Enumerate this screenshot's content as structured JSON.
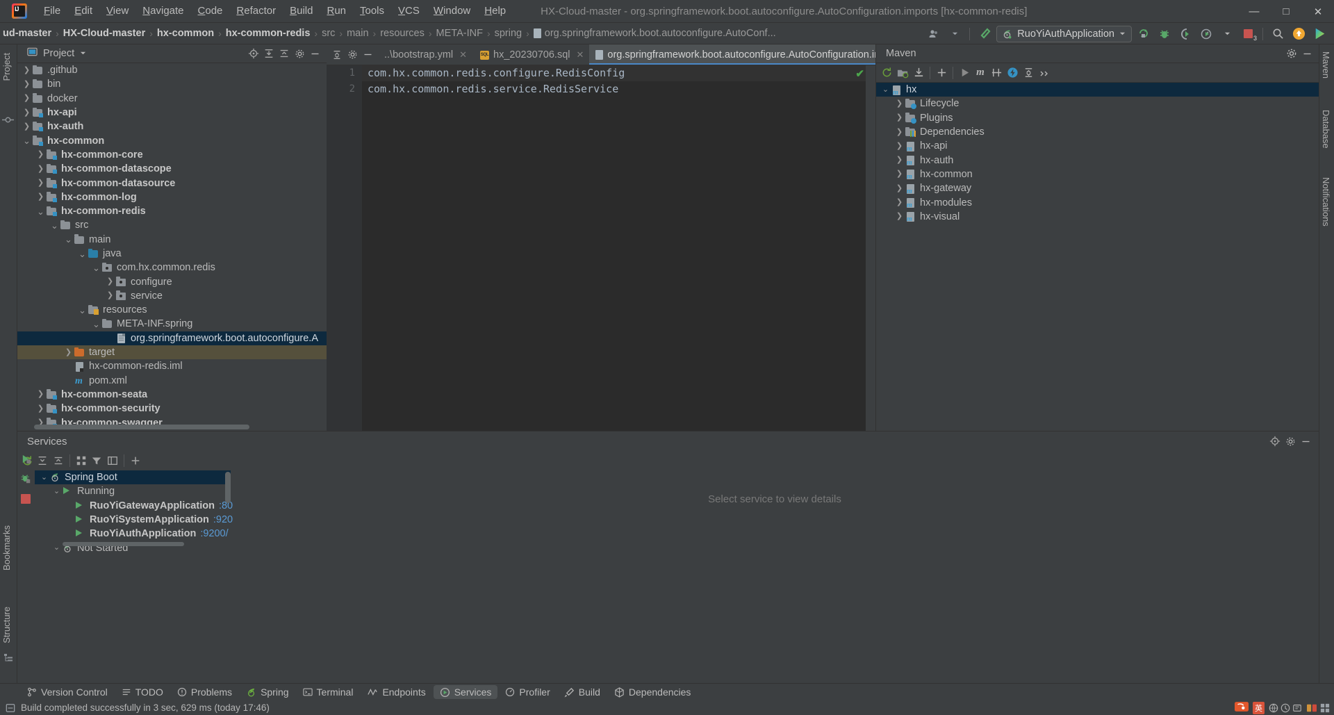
{
  "window": {
    "title": "HX-Cloud-master - org.springframework.boot.autoconfigure.AutoConfiguration.imports [hx-common-redis]",
    "minimize": "—",
    "maximize": "▢",
    "close": "✕"
  },
  "menu": [
    "File",
    "Edit",
    "View",
    "Navigate",
    "Code",
    "Refactor",
    "Build",
    "Run",
    "Tools",
    "VCS",
    "Window",
    "Help"
  ],
  "breadcrumbs": [
    {
      "label": "ud-master",
      "style": "bold"
    },
    {
      "label": "HX-Cloud-master",
      "style": "bold"
    },
    {
      "label": "hx-common",
      "style": "bold"
    },
    {
      "label": "hx-common-redis",
      "style": "bold"
    },
    {
      "label": "src",
      "style": "dim"
    },
    {
      "label": "main",
      "style": "dim"
    },
    {
      "label": "resources",
      "style": "dim"
    },
    {
      "label": "META-INF",
      "style": "dim"
    },
    {
      "label": "spring",
      "style": "dim"
    },
    {
      "label": "org.springframework.boot.autoconfigure.AutoConf...",
      "style": "dim"
    }
  ],
  "nav_toolbar": {
    "account_icon": "user-avatar-icon",
    "dropdown_icon": "chevron-down-icon",
    "build_icon": "hammer-icon",
    "run_config": "RuoYiAuthApplication",
    "run_config_icon": "spring-boot-icon",
    "rerun_icon": "rerun-icon",
    "debug_icon": "debug-icon",
    "coverage_icon": "coverage-icon",
    "profiler_icon": "profiler-icon",
    "more_icon": "chevron-down-icon",
    "stop_icon": "stop-icon",
    "stop_badge": "3",
    "search_icon": "search-icon",
    "update_icon": "update-arrow-icon",
    "ai_icon": "ai-assistant-icon"
  },
  "project_panel": {
    "title": "Project",
    "title_icon": "project-view-icon",
    "dropdown_icon": "chevron-down-icon",
    "actions": [
      "locate-icon",
      "expand-all-icon",
      "collapse-all-icon",
      "settings-icon",
      "hide-icon"
    ],
    "tree": [
      {
        "label": ".github",
        "depth": 2,
        "arrow": "right",
        "icon": "folder",
        "bold": false
      },
      {
        "label": "bin",
        "depth": 2,
        "arrow": "right",
        "icon": "folder",
        "bold": false
      },
      {
        "label": "docker",
        "depth": 2,
        "arrow": "right",
        "icon": "folder",
        "bold": false
      },
      {
        "label": "hx-api",
        "depth": 2,
        "arrow": "right",
        "icon": "module",
        "bold": true
      },
      {
        "label": "hx-auth",
        "depth": 2,
        "arrow": "right",
        "icon": "module",
        "bold": true
      },
      {
        "label": "hx-common",
        "depth": 2,
        "arrow": "down",
        "icon": "module",
        "bold": true
      },
      {
        "label": "hx-common-core",
        "depth": 3,
        "arrow": "right",
        "icon": "module",
        "bold": true
      },
      {
        "label": "hx-common-datascope",
        "depth": 3,
        "arrow": "right",
        "icon": "module",
        "bold": true
      },
      {
        "label": "hx-common-datasource",
        "depth": 3,
        "arrow": "right",
        "icon": "module",
        "bold": true
      },
      {
        "label": "hx-common-log",
        "depth": 3,
        "arrow": "right",
        "icon": "module",
        "bold": true
      },
      {
        "label": "hx-common-redis",
        "depth": 3,
        "arrow": "down",
        "icon": "module",
        "bold": true
      },
      {
        "label": "src",
        "depth": 4,
        "arrow": "down",
        "icon": "folder",
        "bold": false
      },
      {
        "label": "main",
        "depth": 5,
        "arrow": "down",
        "icon": "folder",
        "bold": false
      },
      {
        "label": "java",
        "depth": 6,
        "arrow": "down",
        "icon": "source-folder",
        "bold": false
      },
      {
        "label": "com.hx.common.redis",
        "depth": 7,
        "arrow": "down",
        "icon": "package",
        "bold": false
      },
      {
        "label": "configure",
        "depth": 8,
        "arrow": "right",
        "icon": "package",
        "bold": false
      },
      {
        "label": "service",
        "depth": 8,
        "arrow": "right",
        "icon": "package",
        "bold": false
      },
      {
        "label": "resources",
        "depth": 6,
        "arrow": "down",
        "icon": "resources-folder",
        "bold": false
      },
      {
        "label": "META-INF.spring",
        "depth": 7,
        "arrow": "down",
        "icon": "folder",
        "bold": false
      },
      {
        "label": "org.springframework.boot.autoconfigure.A",
        "depth": 8,
        "arrow": "none",
        "icon": "file",
        "bold": false,
        "selected": true
      },
      {
        "label": "target",
        "depth": 5,
        "arrow": "right",
        "icon": "target-folder",
        "bold": false,
        "excluded": true
      },
      {
        "label": "hx-common-redis.iml",
        "depth": 5,
        "arrow": "none",
        "icon": "iml",
        "bold": false
      },
      {
        "label": "pom.xml",
        "depth": 5,
        "arrow": "none",
        "icon": "maven",
        "bold": false
      },
      {
        "label": "hx-common-seata",
        "depth": 3,
        "arrow": "right",
        "icon": "module",
        "bold": true
      },
      {
        "label": "hx-common-security",
        "depth": 3,
        "arrow": "right",
        "icon": "module",
        "bold": true
      },
      {
        "label": "hx-common-swagger",
        "depth": 3,
        "arrow": "right",
        "icon": "module",
        "bold": true
      }
    ]
  },
  "editor": {
    "toolbar_icons": [
      "collapse-icon",
      "settings-icon",
      "hide-icon"
    ],
    "tabs": [
      {
        "label": "..\\bootstrap.yml",
        "icon": "yml-icon",
        "active": false,
        "close": "✕"
      },
      {
        "label": "hx_20230706.sql",
        "icon": "sql-icon",
        "active": false,
        "close": "✕"
      },
      {
        "label": "org.springframework.boot.autoconfigure.AutoConfiguration.imports",
        "icon": "file-icon",
        "active": true,
        "close": "✕"
      }
    ],
    "tab_overflow_icon": "chevron-down-icon",
    "tab_options_icon": "more-vertical-icon",
    "lines": [
      {
        "number": "1",
        "text": "com.hx.common.redis.configure.RedisConfig"
      },
      {
        "number": "2",
        "text": "com.hx.common.redis.service.RedisService"
      }
    ],
    "inspection_status": "✔"
  },
  "maven_panel": {
    "title": "Maven",
    "settings_icon": "gear-icon",
    "hide_icon": "hide-icon",
    "toolbar": [
      "reload-icon",
      "add-maven-projects-icon",
      "download-sources-icon",
      "plus-icon",
      "execute-icon",
      "maven-goal-icon",
      "toggle-skip-tests-icon",
      "profiler-icon",
      "collapse-all-icon",
      "more-icon"
    ],
    "tree": [
      {
        "label": "hx",
        "depth": 0,
        "arrow": "down",
        "icon": "maven-project",
        "selected": true
      },
      {
        "label": "Lifecycle",
        "depth": 1,
        "arrow": "right",
        "icon": "lifecycle-folder"
      },
      {
        "label": "Plugins",
        "depth": 1,
        "arrow": "right",
        "icon": "plugins-folder"
      },
      {
        "label": "Dependencies",
        "depth": 1,
        "arrow": "right",
        "icon": "dependencies-folder"
      },
      {
        "label": "hx-api",
        "depth": 1,
        "arrow": "right",
        "icon": "maven-project"
      },
      {
        "label": "hx-auth",
        "depth": 1,
        "arrow": "right",
        "icon": "maven-project"
      },
      {
        "label": "hx-common",
        "depth": 1,
        "arrow": "right",
        "icon": "maven-project"
      },
      {
        "label": "hx-gateway",
        "depth": 1,
        "arrow": "right",
        "icon": "maven-project"
      },
      {
        "label": "hx-modules",
        "depth": 1,
        "arrow": "right",
        "icon": "maven-project"
      },
      {
        "label": "hx-visual",
        "depth": 1,
        "arrow": "right",
        "icon": "maven-project"
      }
    ]
  },
  "services_panel": {
    "title": "Services",
    "header_icons": [
      "locate-icon",
      "settings-icon",
      "hide-icon"
    ],
    "toolbar_icons": [
      "rerun-icon",
      "expand-all-icon",
      "collapse-all-icon",
      "group-icon",
      "filter-icon",
      "layout-icon",
      "add-icon"
    ],
    "stripe_icons": [
      "run-icon",
      "debug-icon",
      "stop-icon"
    ],
    "tree": [
      {
        "label": "Spring Boot",
        "depth": 0,
        "arrow": "down",
        "icon": "spring-boot-icon",
        "selected": true,
        "bold": false
      },
      {
        "label": "Running",
        "depth": 1,
        "arrow": "down",
        "icon": "run-triangle",
        "bold": false
      },
      {
        "label": "RuoYiGatewayApplication",
        "port": ":80",
        "depth": 2,
        "arrow": "none",
        "icon": "run-triangle",
        "bold": true
      },
      {
        "label": "RuoYiSystemApplication",
        "port": ":920",
        "depth": 2,
        "arrow": "none",
        "icon": "run-triangle",
        "bold": true
      },
      {
        "label": "RuoYiAuthApplication",
        "port": ":9200/",
        "depth": 2,
        "arrow": "none",
        "icon": "run-triangle",
        "bold": true
      },
      {
        "label": "Not Started",
        "depth": 1,
        "arrow": "down",
        "icon": "spring-boot-icon",
        "bold": false
      }
    ],
    "empty_message": "Select service to view details"
  },
  "bottom_bar": [
    {
      "label": "Version Control",
      "icon": "branch-icon",
      "active": false
    },
    {
      "label": "TODO",
      "icon": "todo-icon",
      "active": false
    },
    {
      "label": "Problems",
      "icon": "problems-icon",
      "active": false
    },
    {
      "label": "Spring",
      "icon": "spring-icon",
      "active": false
    },
    {
      "label": "Terminal",
      "icon": "terminal-icon",
      "active": false
    },
    {
      "label": "Endpoints",
      "icon": "endpoints-icon",
      "active": false
    },
    {
      "label": "Services",
      "icon": "services-icon",
      "active": true
    },
    {
      "label": "Profiler",
      "icon": "profiler-icon",
      "active": false
    },
    {
      "label": "Build",
      "icon": "build-icon",
      "active": false
    },
    {
      "label": "Dependencies",
      "icon": "dependencies-icon",
      "active": false
    }
  ],
  "status_bar": {
    "icon": "build-status-icon",
    "message": "Build completed successfully in 3 sec, 629 ms (today 17:46)",
    "tray": [
      "sogou-ime-icon",
      "lang-en-badge",
      "ime-tools",
      "tray-more"
    ],
    "lang_badge": "英"
  },
  "left_stripe": [
    "Project",
    "Bookmarks",
    "Structure"
  ],
  "right_stripe": [
    "Maven",
    "Database",
    "Notifications"
  ],
  "colors": {
    "accent_blue": "#4a88c7",
    "selection": "#0d293e",
    "excluded": "#55503c",
    "green": "#59a869",
    "editor_bg": "#2b2b2b",
    "panel_bg": "#3c3f41"
  }
}
